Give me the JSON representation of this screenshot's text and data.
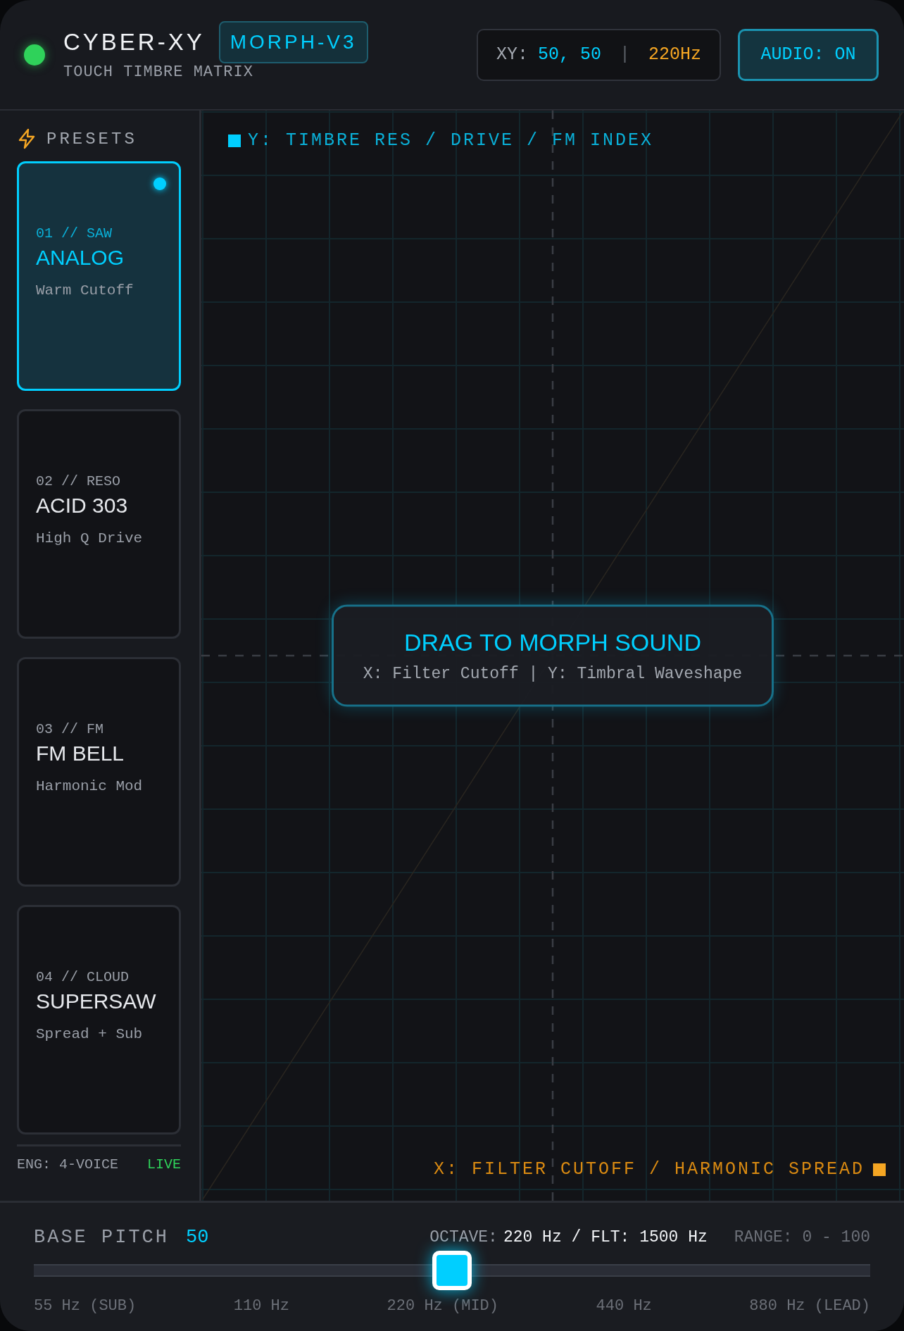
{
  "header": {
    "status_on": true,
    "title": "CYBER-XY",
    "badge": "MORPH-V3",
    "subtitle": "TOUCH TIMBRE MATRIX",
    "readout": {
      "label": "XY:",
      "xy": "50, 50",
      "separator": "|",
      "freq": "220Hz"
    },
    "audio_button": {
      "label": "AUDIO: ON",
      "on": true
    }
  },
  "sidebar": {
    "title": "PRESETS",
    "presets": [
      {
        "code": "01 // SAW",
        "name": "ANALOG",
        "desc": "Warm Cutoff",
        "selected": true
      },
      {
        "code": "02 // RESO",
        "name": "ACID 303",
        "desc": "High Q Drive",
        "selected": false
      },
      {
        "code": "03 // FM",
        "name": "FM BELL",
        "desc": "Harmonic Mod",
        "selected": false
      },
      {
        "code": "04 // CLOUD",
        "name": "SUPERSAW",
        "desc": "Spread + Sub",
        "selected": false
      }
    ],
    "footer": {
      "engine": "ENG: 4-VOICE",
      "status": "LIVE"
    }
  },
  "pad": {
    "y_axis": "Y: TIMBRE RES / DRIVE / FM INDEX",
    "x_axis": "X: FILTER CUTOFF / HARMONIC SPREAD",
    "hint": {
      "title": "DRAG TO MORPH SOUND",
      "subtitle": "X: Filter Cutoff | Y: Timbral Waveshape"
    }
  },
  "pitch": {
    "label": "BASE PITCH",
    "value": "50",
    "octave_label": "OCTAVE:",
    "octave_value": "220 Hz / FLT: 1500 Hz",
    "range": "RANGE: 0 - 100",
    "level": 0.5,
    "ticks": [
      "55 Hz (SUB)",
      "110 Hz",
      "220 Hz (MID)",
      "440 Hz",
      "880 Hz (LEAD)"
    ]
  }
}
